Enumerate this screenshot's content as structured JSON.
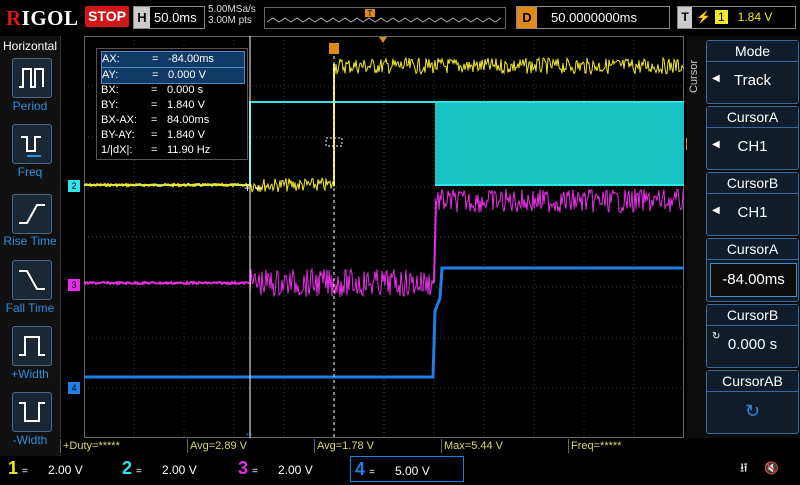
{
  "brand": "RIGOL",
  "run_state": "STOP",
  "timebase": {
    "key": "H",
    "value": "50.0ms"
  },
  "sample_rate": "5.00MSa/s",
  "memory_depth": "3.00M pts",
  "trigger_marker": "T",
  "delay": {
    "key": "D",
    "value": "50.0000000ms"
  },
  "trigger_info": {
    "key": "T",
    "source": "1",
    "level": "1.84 V"
  },
  "left_menu": {
    "title": "Horizontal",
    "items": [
      "Period",
      "Freq",
      "Rise Time",
      "Fall Time",
      "+Width",
      "-Width"
    ]
  },
  "right_menu": {
    "side_label": "Cursor",
    "items": [
      {
        "title": "Mode",
        "value": "Track"
      },
      {
        "title": "CursorA",
        "value": "CH1"
      },
      {
        "title": "CursorB",
        "value": "CH1"
      },
      {
        "title": "CursorA",
        "value": "-84.00ms"
      },
      {
        "title": "CursorB",
        "value": "0.000 s"
      },
      {
        "title": "CursorAB",
        "value": "↻"
      }
    ]
  },
  "cursor_readout": [
    {
      "name": "AX:",
      "eq": "=",
      "value": "-84.00ms"
    },
    {
      "name": "AY:",
      "eq": "=",
      "value": "0.000 V"
    },
    {
      "name": "BX:",
      "eq": "=",
      "value": "0.000 s"
    },
    {
      "name": "BY:",
      "eq": "=",
      "value": "1.840 V"
    },
    {
      "name": "BX-AX:",
      "eq": "=",
      "value": "84.00ms"
    },
    {
      "name": "BY-AY:",
      "eq": "=",
      "value": "1.840 V"
    },
    {
      "name": "1/|dX|:",
      "eq": "=",
      "value": "11.90 Hz"
    }
  ],
  "measurements": [
    "+Duty=*****",
    "Avg=2.89 V",
    "Avg=1.78 V",
    "Max=5.44 V",
    "Freq=*****"
  ],
  "channels": [
    {
      "num": "1",
      "scale": "2.00 V",
      "color": "#f2e82a"
    },
    {
      "num": "2",
      "scale": "2.00 V",
      "color": "#2ee6e6"
    },
    {
      "num": "3",
      "scale": "2.00 V",
      "color": "#e62ee6"
    },
    {
      "num": "4",
      "scale": "5.00 V",
      "color": "#1e7fe6"
    }
  ],
  "grid_markers": {
    "ch1": "1",
    "ch2": "2",
    "ch3": "3",
    "ch4": "4"
  }
}
